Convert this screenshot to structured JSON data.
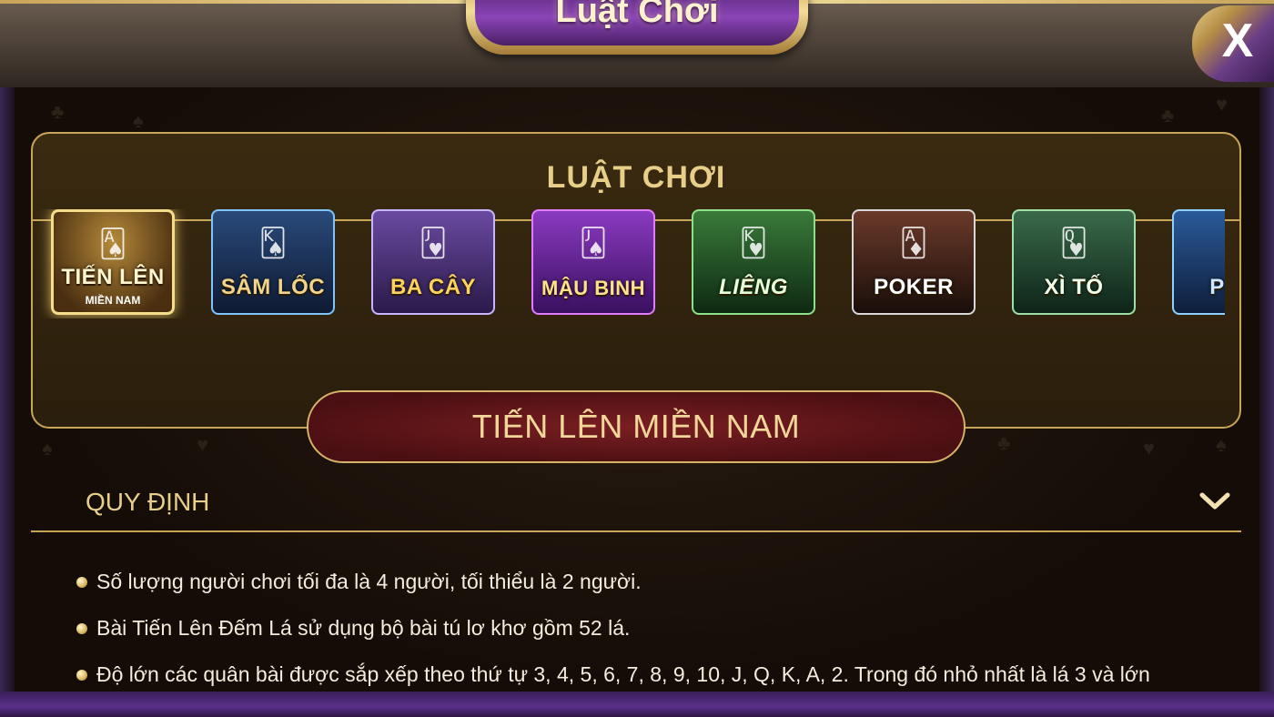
{
  "window": {
    "title": "Luật Chơi",
    "close_label": "X"
  },
  "panel": {
    "title": "LUẬT CHƠI"
  },
  "games": [
    {
      "label": "TIẾN LÊN",
      "sublabel": "MIỀN NAM",
      "selected": true
    },
    {
      "label": "SÂM LỐC"
    },
    {
      "label": "BA CÂY"
    },
    {
      "label": "MẬU BINH"
    },
    {
      "label": "LIÊNG"
    },
    {
      "label": "POKER"
    },
    {
      "label": "XÌ TỐ"
    },
    {
      "label": "PHỎ"
    }
  ],
  "selected_game": {
    "title": "TIẾN LÊN MIỀN NAM"
  },
  "section": {
    "title": "QUY ĐỊNH",
    "icon": "chevron-down-icon",
    "rules": [
      "Số lượng người chơi tối đa là 4 người, tối thiểu là 2 người.",
      "Bài Tiến Lên Đếm Lá sử dụng bộ bài tú lơ khơ gồm 52 lá.",
      "Độ lớn các quân bài được sắp xếp theo thứ tự 3, 4, 5, 6, 7, 8, 9, 10, J, Q, K, A, 2. Trong đó nhỏ nhất là lá 3 và lớn"
    ]
  },
  "colors": {
    "gold": "#c9a55a",
    "gold_text": "#e7cf8a",
    "panel_bg": "#3a2a10",
    "banner_red": "#7a1e22",
    "purple": "#5d2a7e"
  }
}
